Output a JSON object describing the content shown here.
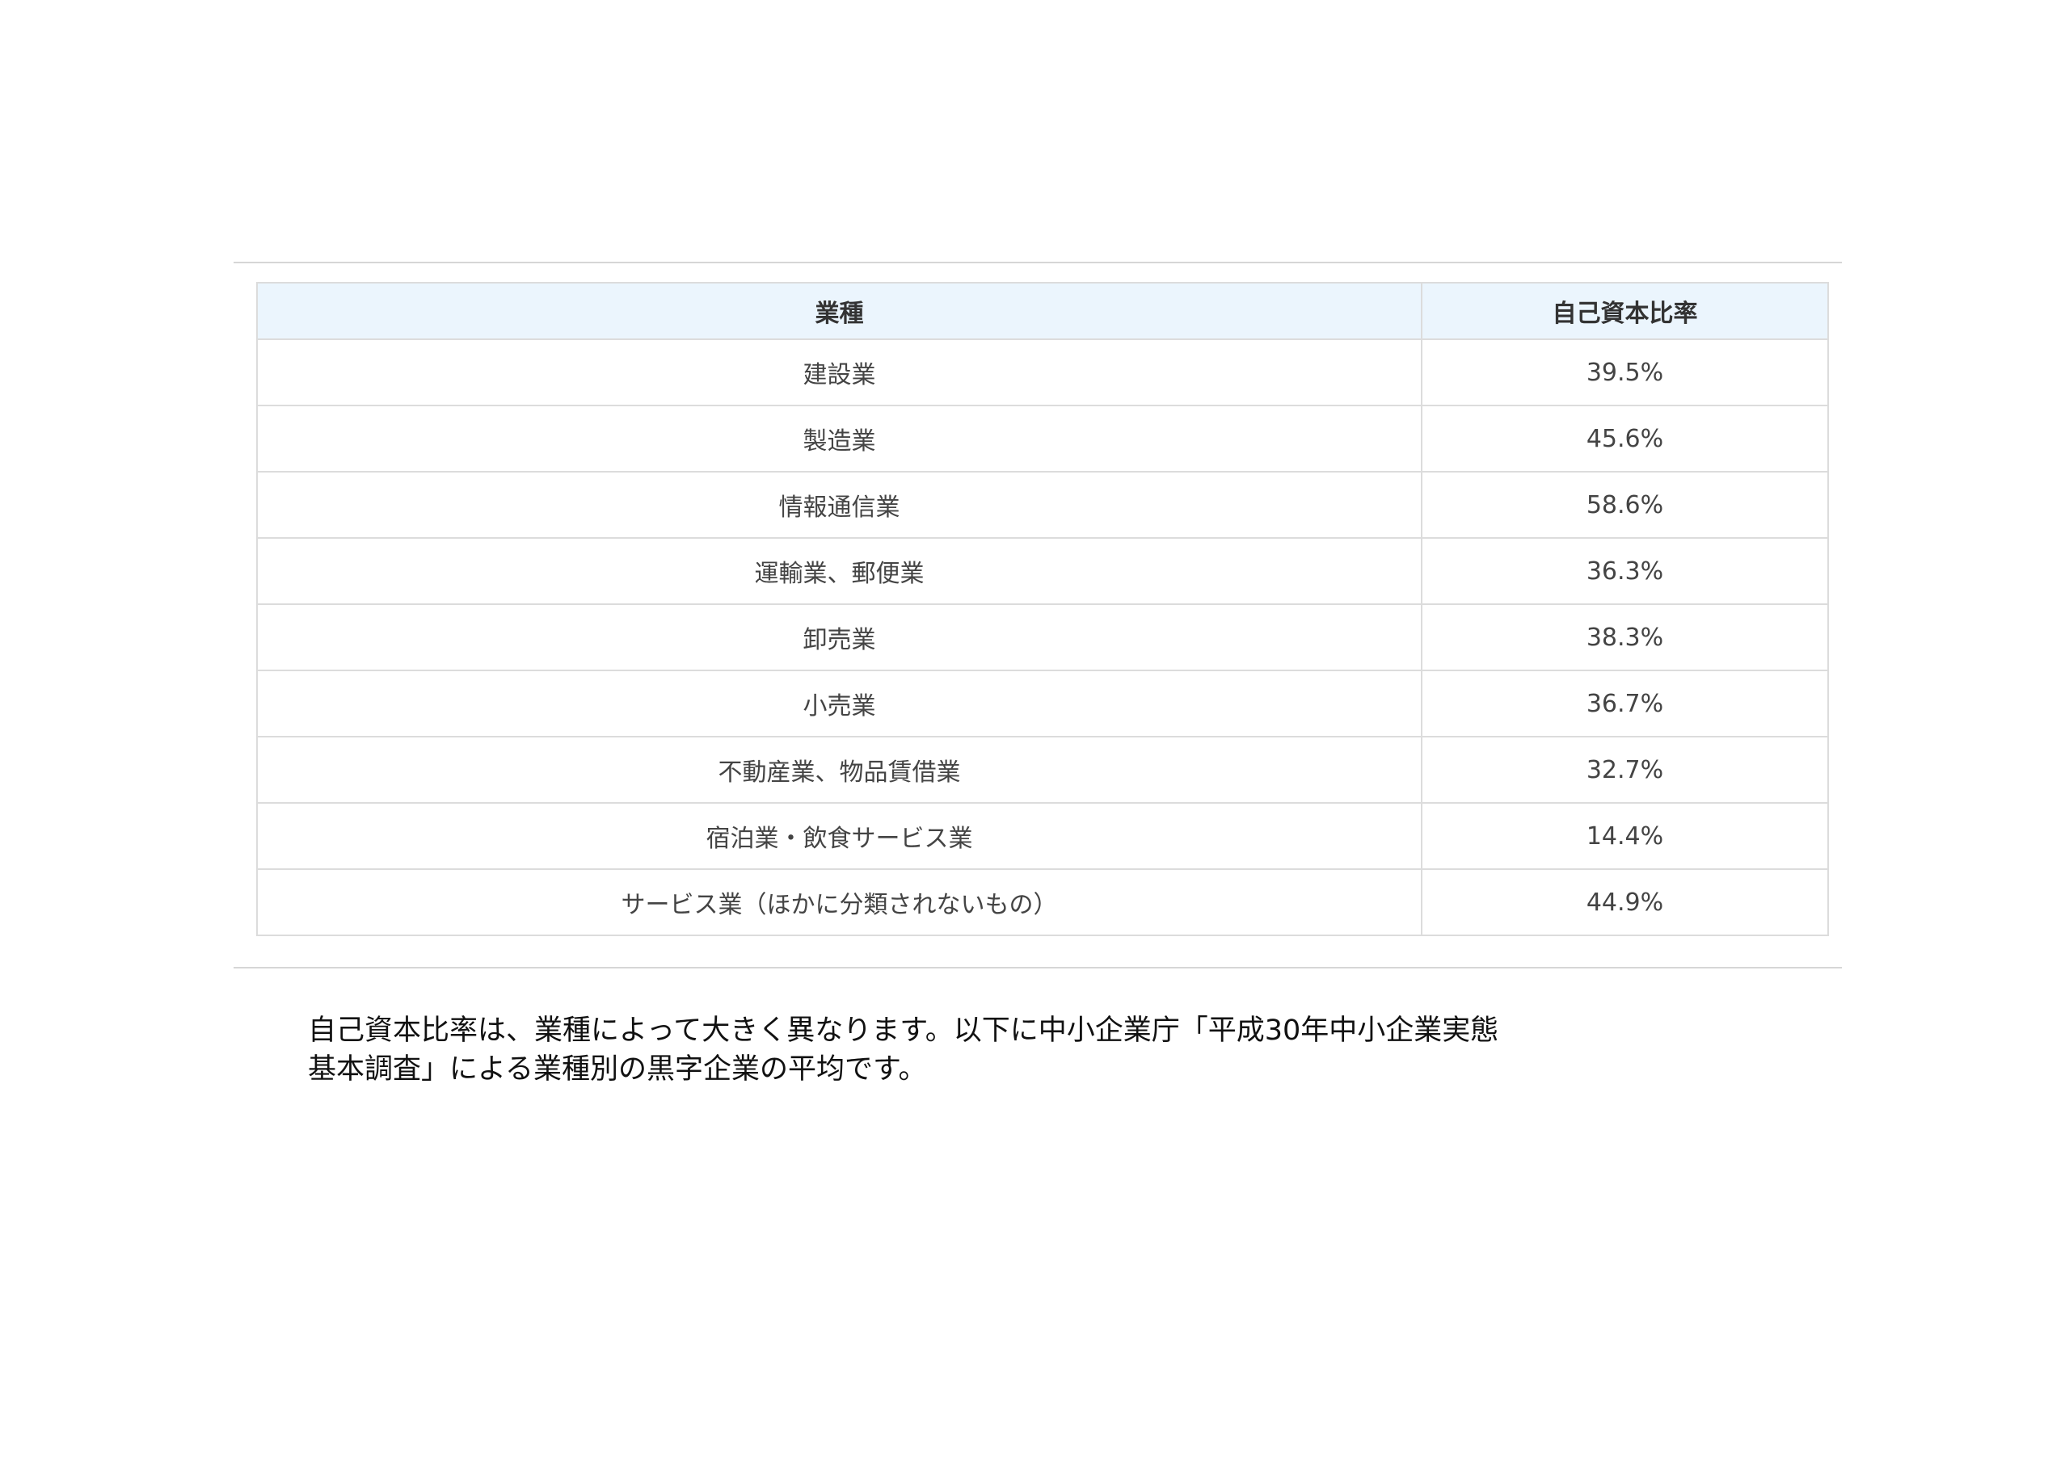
{
  "table": {
    "headers": [
      "業種",
      "自己資本比率"
    ],
    "rows": [
      [
        "建設業",
        "39.5%"
      ],
      [
        "製造業",
        "45.6%"
      ],
      [
        "情報通信業",
        "58.6%"
      ],
      [
        "運輸業、郵便業",
        "36.3%"
      ],
      [
        "卸売業",
        "38.3%"
      ],
      [
        "小売業",
        "36.7%"
      ],
      [
        "不動産業、物品賃借業",
        "32.7%"
      ],
      [
        "宿泊業・飲食サービス業",
        "14.4%"
      ],
      [
        "サービス業（ほかに分類されないもの）",
        "44.9%"
      ]
    ]
  },
  "caption": {
    "line1": "自己資本比率は、業種によって大きく異なります。以下に中小企業庁「平成30年中小企業実態",
    "line2": "基本調査」による業種別の黒字企業の平均です。"
  }
}
